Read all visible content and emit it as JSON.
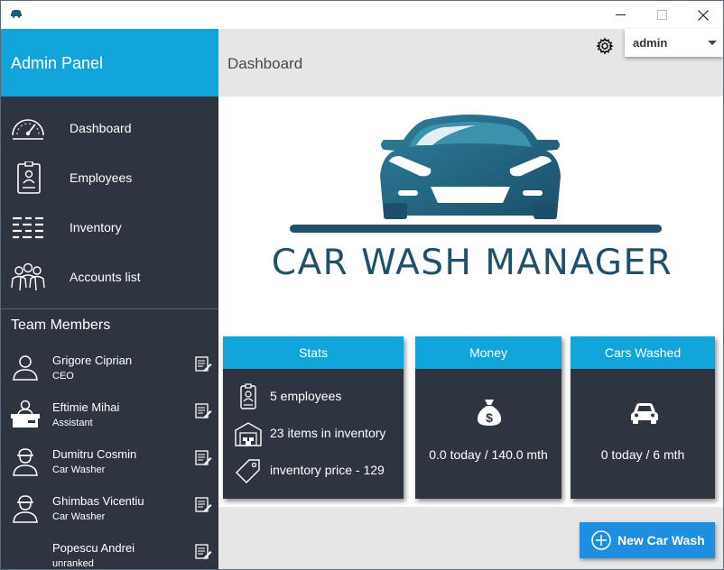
{
  "window": {
    "icon": "car-icon",
    "controls": [
      "minimize-icon",
      "maximize-icon",
      "close-icon"
    ]
  },
  "sidebar": {
    "title": "Admin Panel",
    "nav": [
      {
        "label": "Dashboard",
        "icon": "speedometer-icon"
      },
      {
        "label": "Employees",
        "icon": "id-badge-icon"
      },
      {
        "label": "Inventory",
        "icon": "list-icon"
      },
      {
        "label": "Accounts list",
        "icon": "users-icon"
      }
    ],
    "team_title": "Team Members",
    "members": [
      {
        "name": "Grigore Ciprian",
        "role": "CEO",
        "icon": "person-icon"
      },
      {
        "name": "Eftimie Mihai",
        "role": "Assistant",
        "icon": "desk-person-icon"
      },
      {
        "name": "Dumitru Cosmin",
        "role": "Car Washer",
        "icon": "worker-icon"
      },
      {
        "name": "Ghimbas Vicentiu",
        "role": "Car Washer",
        "icon": "worker-icon"
      },
      {
        "name": "Popescu Andrei",
        "role": "unranked",
        "icon": "none"
      }
    ]
  },
  "header": {
    "title": "Dashboard",
    "user": "admin"
  },
  "logo": {
    "text": "CAR WASH MANAGER"
  },
  "cards": {
    "stats": {
      "title": "Stats",
      "rows": [
        "5 employees",
        "23 items in inventory",
        "inventory price - 129"
      ]
    },
    "money": {
      "title": "Money",
      "value": "0.0 today / 140.0 mth"
    },
    "cars": {
      "title": "Cars Washed",
      "value": "0 today / 6 mth"
    }
  },
  "actions": {
    "new_wash": "New Car Wash"
  },
  "colors": {
    "accent": "#12a5dc",
    "sidebar": "#2f3441",
    "button": "#1e8fe0",
    "logo": "#21506a"
  }
}
